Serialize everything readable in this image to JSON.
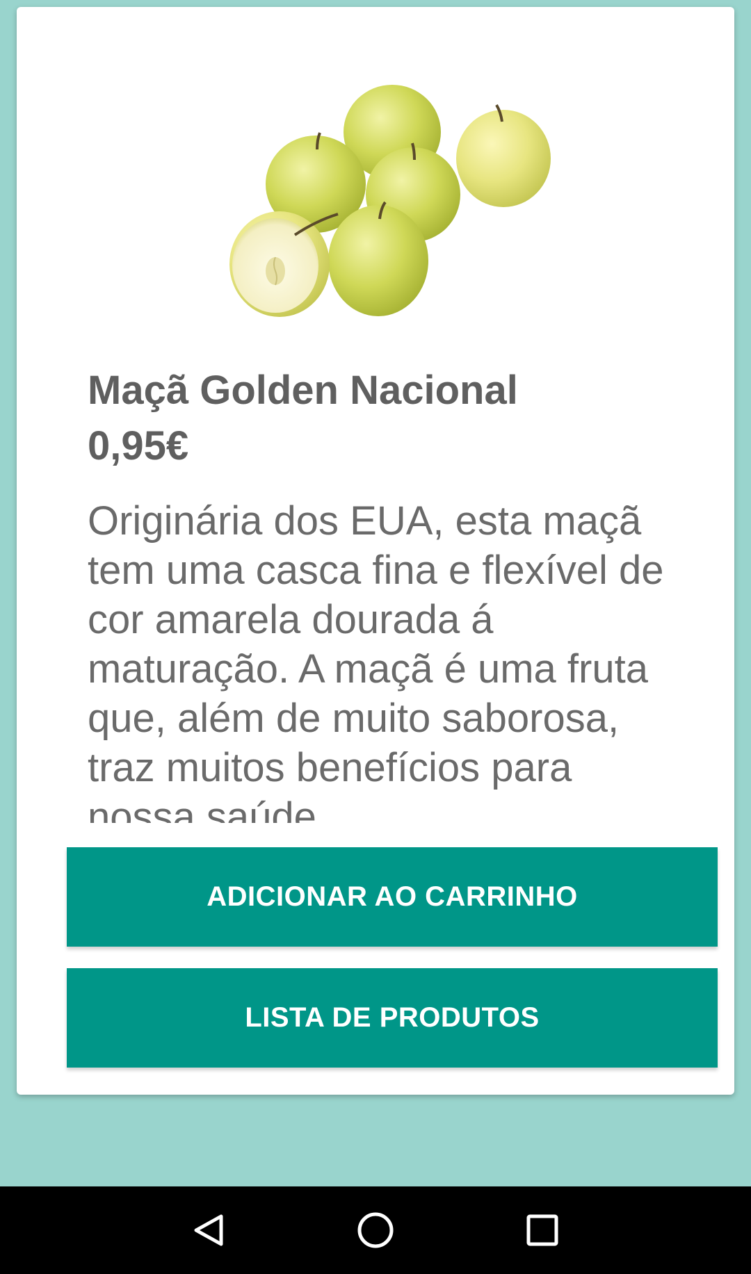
{
  "product": {
    "name": "Maçã Golden Nacional",
    "price": "0,95€",
    "description": "Originária dos EUA, esta maçã tem uma casca fina e flexível de cor amarela dourada á maturação. A maçã é uma fruta que, além de muito saborosa, traz muitos benefícios para nossa saúde",
    "image_icon": "golden-apples-image"
  },
  "actions": {
    "add_to_cart_label": "ADICIONAR AO CARRINHO",
    "product_list_label": "LISTA DE PRODUTOS"
  },
  "navbar": {
    "back_icon": "back-triangle-icon",
    "home_icon": "home-circle-icon",
    "recents_icon": "recents-square-icon"
  },
  "colors": {
    "background": "#99d4cd",
    "accent": "#009688",
    "card": "#ffffff",
    "text": "#5f5f5f",
    "navbar": "#000000"
  }
}
